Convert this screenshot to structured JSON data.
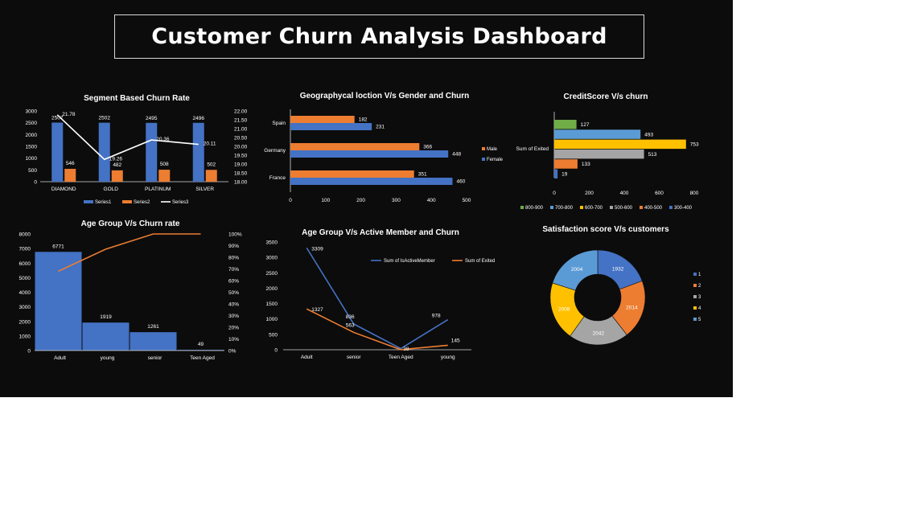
{
  "page": {
    "title": "Customer Churn Analysis Dashboard"
  },
  "colors": {
    "background": "#0c0c0c",
    "blue": "#4472c4",
    "orange": "#ed7d31",
    "white": "#ffffff",
    "gray": "#a5a5a5",
    "yellow": "#ffc000",
    "lightblue": "#5b9bd5",
    "green": "#70ad47"
  },
  "chart_data": [
    {
      "id": "segment",
      "type": "bar",
      "title": "Segment Based Churn Rate",
      "categories": [
        "DIAMOND",
        "GOLD",
        "PLATINUM",
        "SILVER"
      ],
      "series": [
        {
          "name": "Series1",
          "values": [
            2507,
            2502,
            2495,
            2496
          ],
          "axis": "left",
          "kind": "bar"
        },
        {
          "name": "Series2",
          "values": [
            546,
            482,
            508,
            502
          ],
          "axis": "left",
          "kind": "bar"
        },
        {
          "name": "Series3",
          "values": [
            21.78,
            19.26,
            20.36,
            20.11
          ],
          "axis": "right",
          "kind": "line"
        }
      ],
      "y_ticks": [
        "0",
        "500",
        "1000",
        "1500",
        "2000",
        "2500",
        "3000"
      ],
      "y2_ticks": [
        "18.00",
        "18.50",
        "19.00",
        "19.50",
        "20.00",
        "20.50",
        "21.00",
        "21.50",
        "22.00"
      ],
      "ylim": [
        0,
        3000
      ],
      "y2lim": [
        18,
        22
      ],
      "legend": "bottom"
    },
    {
      "id": "geo",
      "type": "bar",
      "orientation": "horizontal",
      "title": "Geographycal loction V/s Gender and Churn",
      "categories": [
        "Spain",
        "Germany",
        "France"
      ],
      "series": [
        {
          "name": "Male",
          "values": [
            182,
            366,
            351
          ]
        },
        {
          "name": "Female",
          "values": [
            231,
            448,
            460
          ]
        }
      ],
      "x_ticks": [
        "0",
        "100",
        "200",
        "300",
        "400",
        "500"
      ],
      "xlim": [
        0,
        500
      ],
      "legend": "right"
    },
    {
      "id": "credit",
      "type": "bar",
      "orientation": "horizontal",
      "title": "CreditScore  V/s churn",
      "category_label": "Sum of Exited",
      "series": [
        {
          "name": "800-900",
          "value": 127
        },
        {
          "name": "700-800",
          "value": 493
        },
        {
          "name": "600-700",
          "value": 753
        },
        {
          "name": "500-600",
          "value": 513
        },
        {
          "name": "400-500",
          "value": 133
        },
        {
          "name": "300-400",
          "value": 19
        }
      ],
      "x_ticks": [
        "0",
        "200",
        "400",
        "600",
        "800"
      ],
      "xlim": [
        0,
        800
      ],
      "legend": "bottom"
    },
    {
      "id": "agechurn",
      "type": "bar",
      "title": "Age Group V/s Churn rate",
      "categories": [
        "Adult",
        "young",
        "senior",
        "Teen Aged"
      ],
      "series": [
        {
          "kind": "bar",
          "values": [
            6771,
            1919,
            1261,
            49
          ],
          "axis": "left"
        },
        {
          "kind": "line",
          "values": [
            0.68,
            0.87,
            1.0,
            1.0
          ],
          "axis": "right"
        }
      ],
      "y_ticks": [
        "0",
        "1000",
        "2000",
        "3000",
        "4000",
        "5000",
        "6000",
        "7000",
        "8000"
      ],
      "y2_ticks": [
        "0%",
        "10%",
        "20%",
        "30%",
        "40%",
        "50%",
        "60%",
        "70%",
        "80%",
        "90%",
        "100%"
      ],
      "ylim": [
        0,
        8000
      ],
      "y2lim": [
        0,
        1
      ]
    },
    {
      "id": "ageactive",
      "type": "line",
      "title": "Age Group V/s Active Member and Churn",
      "categories": [
        "Adult",
        "senior",
        "Teen Aged",
        "young"
      ],
      "series": [
        {
          "name": "Sum of IsActiveMember",
          "values": [
            3309,
            836,
            38,
            978
          ],
          "labels": [
            "3309",
            "836",
            "",
            "978"
          ]
        },
        {
          "name": "Sum of Exited",
          "values": [
            1327,
            563,
            3,
            145
          ],
          "labels": [
            "1327",
            "563",
            "38",
            "145"
          ]
        }
      ],
      "y_ticks": [
        "0",
        "500",
        "1000",
        "1500",
        "2000",
        "2500",
        "3000",
        "3500"
      ],
      "ylim": [
        0,
        3500
      ],
      "legend": "top-right"
    },
    {
      "id": "satisfaction",
      "type": "pie",
      "style": "donut",
      "title": "Satisfaction score V/s customers",
      "series": [
        {
          "name": "1",
          "value": 1932
        },
        {
          "name": "2",
          "value": 2014
        },
        {
          "name": "3",
          "value": 2042
        },
        {
          "name": "4",
          "value": 2008
        },
        {
          "name": "5",
          "value": 2004
        }
      ],
      "legend": "right"
    }
  ]
}
